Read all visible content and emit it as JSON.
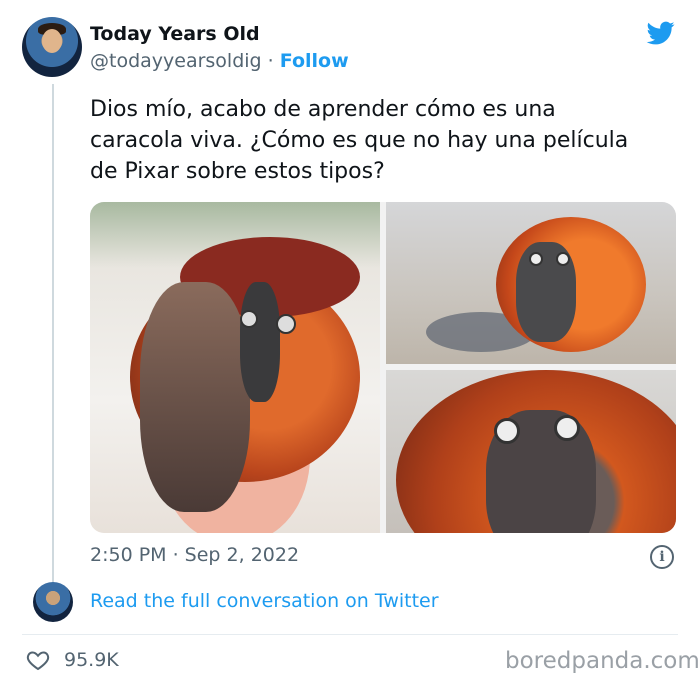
{
  "author": {
    "name": "Today Years Old",
    "handle": "@todayyearsoldig",
    "separator": " · ",
    "follow_label": "Follow"
  },
  "tweet": {
    "text_lines": [
      "Dios mío, acabo de aprender cómo es una",
      "caracola viva. ¿Cómo es que no hay una película",
      "de Pixar sobre estos tipos?"
    ],
    "timestamp": "2:50 PM · Sep 2, 2022"
  },
  "actions": {
    "read_conversation": "Read the full conversation on Twitter",
    "likes": "95.9K"
  },
  "watermark": "boredpanda.com",
  "icons": {
    "brand": "twitter-bird-icon",
    "info": "info-icon",
    "like": "heart-icon"
  },
  "colors": {
    "accent": "#1d9bf0",
    "text": "#0f1419",
    "muted": "#536471"
  }
}
